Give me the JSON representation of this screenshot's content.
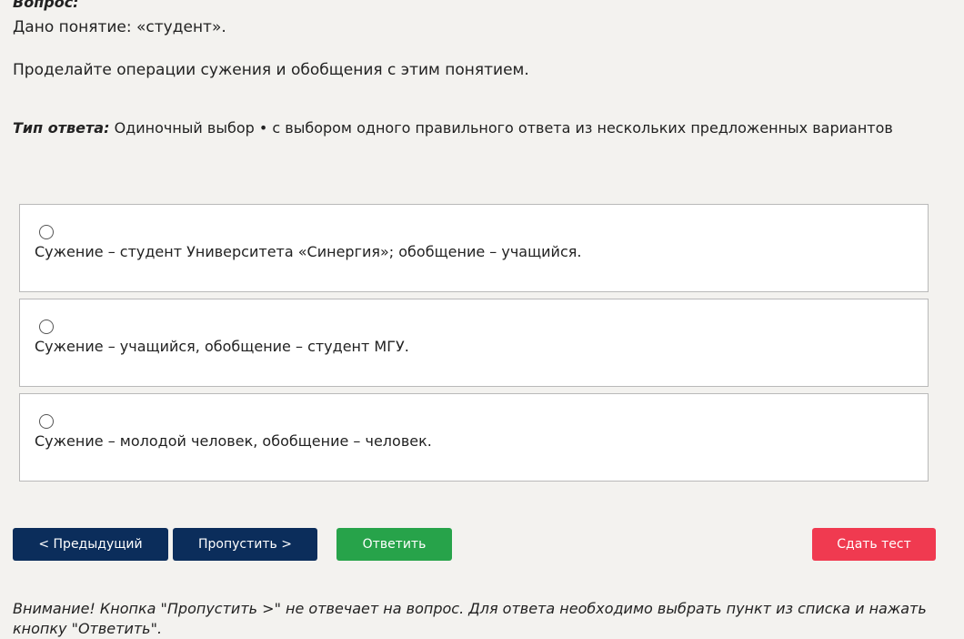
{
  "question": {
    "label": "Вопрос:",
    "line1": "Дано понятие: «студент».",
    "line2": "Проделайте операции сужения и обобщения с этим понятием."
  },
  "answer_type": {
    "label": "Тип ответа:",
    "value": "Одиночный выбор • с выбором одного правильного ответа из нескольких предложенных вариантов"
  },
  "options": [
    {
      "text": "Сужение – студент Университета «Синергия»; обобщение – учащийся.",
      "selected": false
    },
    {
      "text": "Сужение – учащийся, обобщение – студент МГУ.",
      "selected": false
    },
    {
      "text": "Сужение – молодой человек, обобщение – человек.",
      "selected": false
    }
  ],
  "buttons": {
    "prev": "< Предыдущий",
    "skip": "Пропустить >",
    "answer": "Ответить",
    "finish": "Сдать тест"
  },
  "notice": "Внимание! Кнопка \"Пропустить >\" не отвечает на вопрос. Для ответа необходимо выбрать пункт из списка и нажать кнопку \"Ответить\".",
  "colors": {
    "background": "#f3f2ef",
    "nav_button": "#0b2d5b",
    "answer_button": "#27a34a",
    "finish_button": "#f03a50"
  }
}
